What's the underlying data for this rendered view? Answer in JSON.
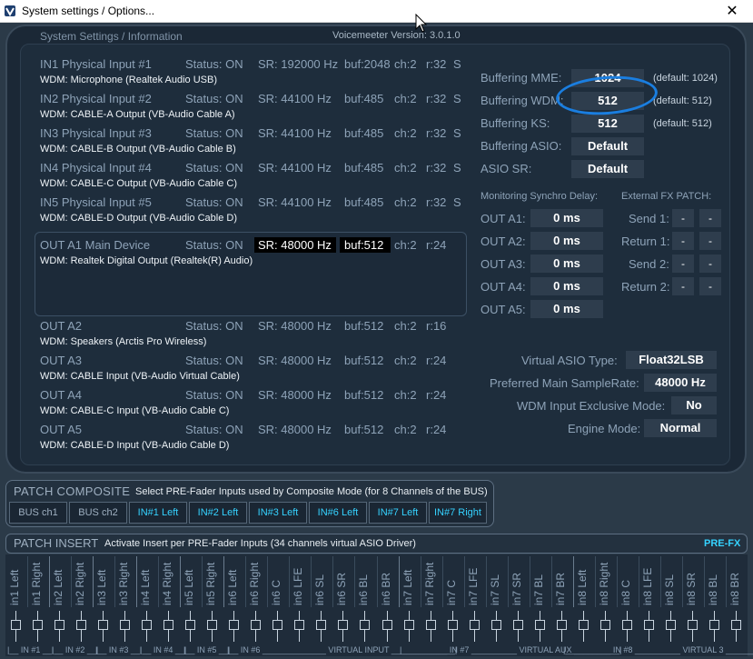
{
  "window": {
    "title": "System settings / Options...",
    "close": "✕"
  },
  "header": {
    "left": "System Settings / Information",
    "version": "Voicemeeter Version: 3.0.1.0"
  },
  "inputs": [
    {
      "name": "IN1 Physical Input #1",
      "status": "Status: ON",
      "sr": "SR: 192000 Hz",
      "buf": "buf:2048",
      "ch": "ch:2",
      "r": "r:32",
      "s": "S",
      "wdm": "WDM: Microphone (Realtek Audio USB)"
    },
    {
      "name": "IN2 Physical Input #2",
      "status": "Status: ON",
      "sr": "SR: 44100 Hz",
      "buf": "buf:485",
      "ch": "ch:2",
      "r": "r:32",
      "s": "S",
      "wdm": "WDM: CABLE-A Output (VB-Audio Cable A)"
    },
    {
      "name": "IN3 Physical Input #3",
      "status": "Status: ON",
      "sr": "SR: 44100 Hz",
      "buf": "buf:485",
      "ch": "ch:2",
      "r": "r:32",
      "s": "S",
      "wdm": "WDM: CABLE-B Output (VB-Audio Cable B)"
    },
    {
      "name": "IN4 Physical Input #4",
      "status": "Status: ON",
      "sr": "SR: 44100 Hz",
      "buf": "buf:485",
      "ch": "ch:2",
      "r": "r:32",
      "s": "S",
      "wdm": "WDM: CABLE-C Output (VB-Audio Cable C)"
    },
    {
      "name": "IN5 Physical Input #5",
      "status": "Status: ON",
      "sr": "SR: 44100 Hz",
      "buf": "buf:485",
      "ch": "ch:2",
      "r": "r:32",
      "s": "S",
      "wdm": "WDM: CABLE-D Output (VB-Audio Cable D)"
    }
  ],
  "outputs": [
    {
      "name": "OUT A1 Main Device",
      "status": "Status: ON",
      "sr": "SR: 48000 Hz",
      "buf": "buf:512",
      "ch": "ch:2",
      "r": "r:24",
      "wdm": "WDM: Realtek Digital Output (Realtek(R) Audio)"
    },
    {
      "name": "OUT A2",
      "status": "Status: ON",
      "sr": "SR: 48000 Hz",
      "buf": "buf:512",
      "ch": "ch:2",
      "r": "r:16",
      "wdm": "WDM: Speakers (Arctis Pro Wireless)"
    },
    {
      "name": "OUT A3",
      "status": "Status: ON",
      "sr": "SR: 48000 Hz",
      "buf": "buf:512",
      "ch": "ch:2",
      "r": "r:24",
      "wdm": "WDM: CABLE Input (VB-Audio Virtual Cable)"
    },
    {
      "name": "OUT A4",
      "status": "Status: ON",
      "sr": "SR: 48000 Hz",
      "buf": "buf:512",
      "ch": "ch:2",
      "r": "r:24",
      "wdm": "WDM: CABLE-C Input (VB-Audio Cable C)"
    },
    {
      "name": "OUT A5",
      "status": "Status: ON",
      "sr": "SR: 48000 Hz",
      "buf": "buf:512",
      "ch": "ch:2",
      "r": "r:24",
      "wdm": "WDM: CABLE-D Input (VB-Audio Cable D)"
    }
  ],
  "buffering": {
    "mme": {
      "label": "Buffering MME:",
      "value": "1024",
      "default": "(default: 1024)"
    },
    "wdm": {
      "label": "Buffering WDM:",
      "value": "512",
      "default": "(default: 512)"
    },
    "ks": {
      "label": "Buffering KS:",
      "value": "512",
      "default": "(default: 512)"
    },
    "asio": {
      "label": "Buffering ASIO:",
      "value": "Default"
    },
    "asio_sr": {
      "label": "ASIO SR:",
      "value": "Default"
    }
  },
  "sync": {
    "title": "Monitoring Synchro Delay:",
    "rows": [
      {
        "label": "OUT A1:",
        "value": "0 ms"
      },
      {
        "label": "OUT A2:",
        "value": "0 ms"
      },
      {
        "label": "OUT A3:",
        "value": "0 ms"
      },
      {
        "label": "OUT A4:",
        "value": "0 ms"
      },
      {
        "label": "OUT A5:",
        "value": "0 ms"
      }
    ]
  },
  "fx": {
    "title": "External FX PATCH:",
    "rows": [
      {
        "label": "Send 1:",
        "a": "-",
        "b": "-"
      },
      {
        "label": "Return 1:",
        "a": "-",
        "b": "-"
      },
      {
        "label": "Send 2:",
        "a": "-",
        "b": "-"
      },
      {
        "label": "Return 2:",
        "a": "-",
        "b": "-"
      }
    ]
  },
  "engine": {
    "asio_type": {
      "label": "Virtual ASIO Type:",
      "value": "Float32LSB"
    },
    "sample_rate": {
      "label": "Preferred Main SampleRate:",
      "value": "48000 Hz"
    },
    "exclusive": {
      "label": "WDM Input Exclusive Mode:",
      "value": "No"
    },
    "mode": {
      "label": "Engine Mode:",
      "value": "Normal"
    }
  },
  "composite": {
    "title": "PATCH COMPOSITE",
    "desc": "Select PRE-Fader Inputs used by Composite Mode (for 8 Channels of the BUS)",
    "buttons": [
      "BUS ch1",
      "BUS ch2",
      "IN#1 Left",
      "IN#2 Left",
      "IN#3 Left",
      "IN#6 Left",
      "IN#7 Left",
      "IN#7 Right"
    ]
  },
  "insert": {
    "title": "PATCH INSERT",
    "desc": "Activate Insert per PRE-Fader Inputs (34 channels virtual ASIO Driver)",
    "prefx": "PRE-FX",
    "channels": [
      "in1 Left",
      "in1 Right",
      "in2 Left",
      "in2 Right",
      "in3 Left",
      "in3 Right",
      "in4 Left",
      "in4 Right",
      "in5 Left",
      "in5 Right",
      "in6 Left",
      "in6 Right",
      "in6 C",
      "in6 LFE",
      "in6 SL",
      "in6 SR",
      "in6 BL",
      "in6 BR",
      "in7 Left",
      "in7 Right",
      "in7 C",
      "in7 LFE",
      "in7 SL",
      "in7 SR",
      "in7 BL",
      "in7 BR",
      "in8 Left",
      "in8 Right",
      "in8 C",
      "in8 LFE",
      "in8 SL",
      "in8 SR",
      "in8 BL",
      "in8 BR"
    ],
    "groups": [
      "|__ IN #1 __|",
      "|__ IN #2 __|",
      "|__ IN #3 __|",
      "|__ IN #4 __|",
      "|__ IN #5 __|",
      "|__ IN #6 ______________ VIRTUAL INPUT ______________|",
      "|__________ IN #7 __________ VIRTUAL AUX __________|",
      "|__________ IN #8 __________ VIRTUAL 3 __________|"
    ]
  },
  "colors": {
    "accent": "#35d2ff",
    "circle": "#1a7ee0",
    "panel": "#1e2d3c"
  }
}
